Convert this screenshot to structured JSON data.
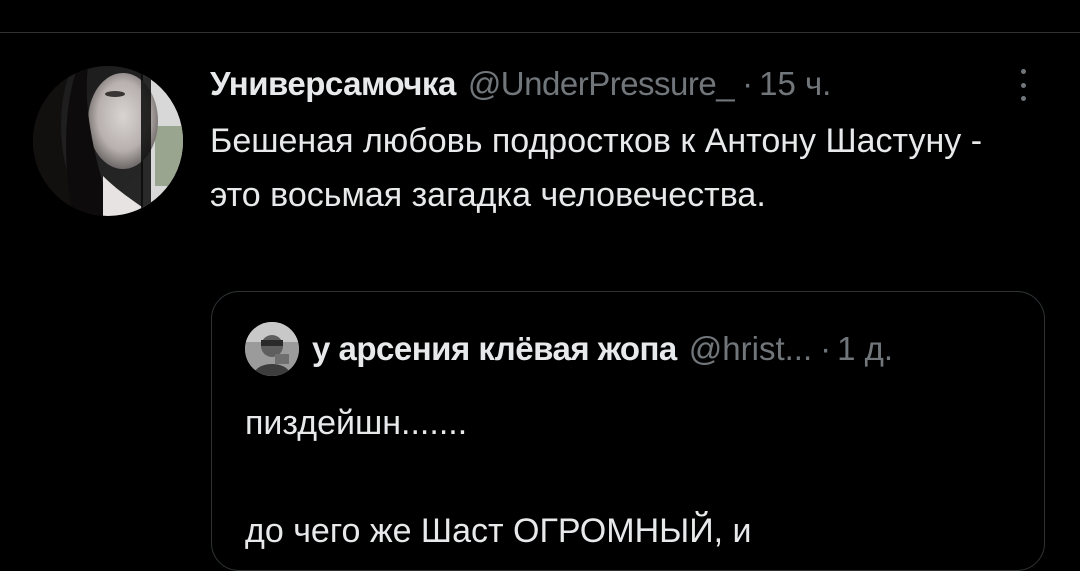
{
  "tweet": {
    "display_name": "Универсамочка",
    "handle": "@UnderPressure_",
    "separator": "·",
    "time": "15 ч.",
    "text": "Бешеная любовь подростков к Антону Шастуну - это восьмая загадка человечества.",
    "avatar_icon": "profile-photo",
    "more_icon": "more-vertical-icon"
  },
  "quote": {
    "display_name": "у арсения клёвая жопа",
    "handle": "@hrist...",
    "separator": "·",
    "time": "1 д.",
    "text_line1": "пиздейшн.......",
    "text_line2": "до чего же Шаст ОГРОМНЫЙ, и"
  },
  "colors": {
    "background": "#000000",
    "primary_text": "#e7e9ea",
    "secondary_text": "#71767b",
    "border": "#2f3336"
  }
}
